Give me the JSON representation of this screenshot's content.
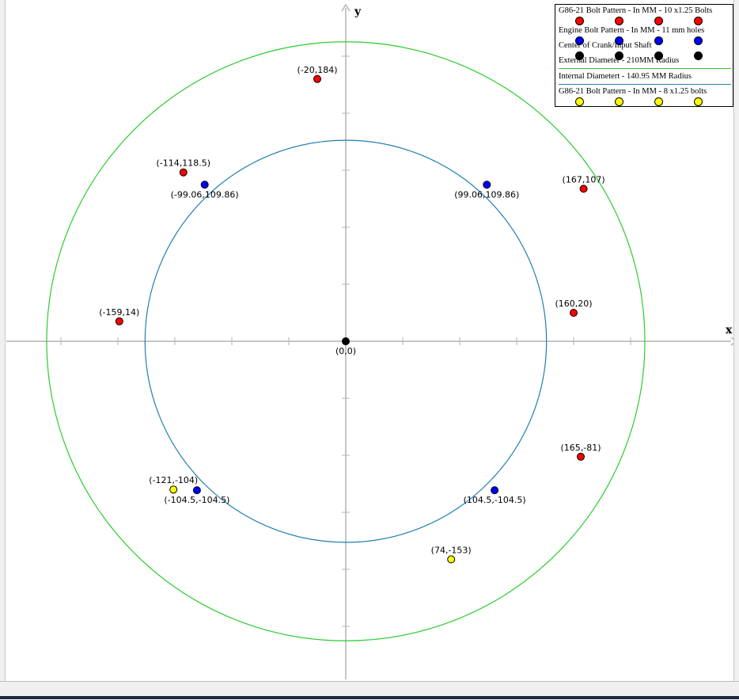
{
  "chart_data": {
    "type": "scatter",
    "title": "",
    "xlabel": "x",
    "ylabel": "y",
    "xlim": [
      -215,
      215
    ],
    "ylim": [
      -200,
      200
    ],
    "grid": false,
    "legend_position": "top-right",
    "axis_tick_step": 40,
    "series": [
      {
        "name": "G86-21 Bolt Pattern - In MM - 10 x1.25 Bolts",
        "color": "#ff0000",
        "points": [
          {
            "x": -20,
            "y": 184,
            "label": "(-20,184)"
          },
          {
            "x": -114,
            "y": 118.5,
            "label": "(-114,118.5)"
          },
          {
            "x": 167,
            "y": 107,
            "label": "(167,107)"
          },
          {
            "x": -159,
            "y": 14,
            "label": "(-159,14)"
          },
          {
            "x": 160,
            "y": 20,
            "label": "(160,20)"
          },
          {
            "x": 165,
            "y": -81,
            "label": "(165,-81)"
          }
        ]
      },
      {
        "name": "Engine Bolt Pattern - In MM - 11 mm holes",
        "color": "#0000ff",
        "points": [
          {
            "x": -99.06,
            "y": 109.86,
            "label": "(-99.06,109.86)"
          },
          {
            "x": 99.06,
            "y": 109.86,
            "label": "(99.06,109.86)"
          },
          {
            "x": -104.5,
            "y": -104.5,
            "label": "(-104.5,-104.5)"
          },
          {
            "x": 104.5,
            "y": -104.5,
            "label": "(104.5,-104.5)"
          }
        ]
      },
      {
        "name": "Center of Crank/Input Shaft",
        "color": "#000000",
        "points": [
          {
            "x": 0,
            "y": 0,
            "label": "(0,0)"
          }
        ]
      },
      {
        "name": "External Diameter - 210MM Radius",
        "color": "#2ecc2e",
        "shape": "circle",
        "radius": 210
      },
      {
        "name": "Internal Diametert - 140.95 MM Radius",
        "color": "#1f7fb0",
        "shape": "circle",
        "radius": 140.95
      },
      {
        "name": "G86-21 Bolt Pattern - In MM - 8 x1.25 bolts",
        "color": "#ffff00",
        "points": [
          {
            "x": -121,
            "y": -104,
            "label": "(-121,-104)"
          },
          {
            "x": 74,
            "y": -153,
            "label": "(74,-153)"
          }
        ]
      }
    ]
  }
}
